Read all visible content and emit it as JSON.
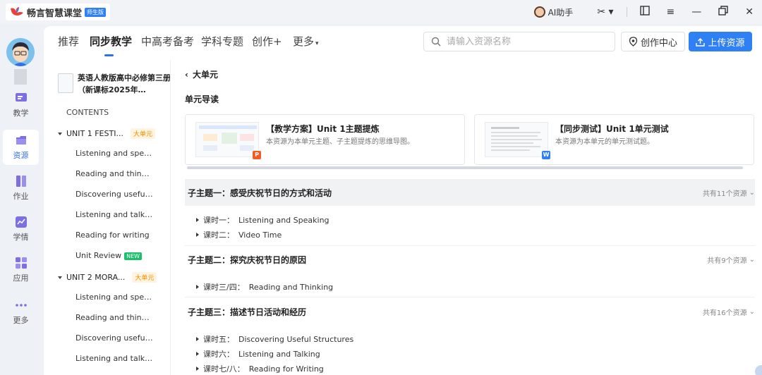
{
  "topbar": {
    "logo_name": "畅言智慧课堂",
    "logo_badge": "师生版",
    "ai_label": "AI助手"
  },
  "rail": {
    "items": [
      {
        "label": "教学",
        "icon": "teach-icon"
      },
      {
        "label": "资源",
        "icon": "resource-icon"
      },
      {
        "label": "作业",
        "icon": "homework-icon"
      },
      {
        "label": "学情",
        "icon": "analytics-icon"
      },
      {
        "label": "应用",
        "icon": "apps-icon"
      },
      {
        "label": "更多",
        "icon": "more-icon"
      }
    ],
    "active": "资源"
  },
  "nav": {
    "tabs": [
      "推荐",
      "同步教学",
      "中高考备考",
      "学科专题",
      "创作+",
      "更多"
    ],
    "active": "同步教学",
    "search_placeholder": "请输入资源名称",
    "center_label": "创作中心",
    "upload_label": "上传资源"
  },
  "toc": {
    "book_title": "英语人教版高中必修第三册（新课标2025年…",
    "contents_label": "CONTENTS",
    "units": [
      {
        "title": "UNIT 1 FESTI...",
        "badge": "大单元",
        "lessons": [
          "Listening and speaking",
          "Reading and thinking",
          "Discovering useful structures",
          "Listening and talking",
          "Reading for writing",
          "Unit Review"
        ],
        "new_badge": "NEW"
      },
      {
        "title": "UNIT 2 MORA...",
        "badge": "大单元",
        "lessons": [
          "Listening and speaking",
          "Reading and thinking",
          "Discovering useful structures",
          "Listening and talking"
        ]
      }
    ]
  },
  "content": {
    "back_label": "大单元",
    "guide_title": "单元导读",
    "cards": [
      {
        "title": "【教学方案】Unit 1主题提炼",
        "desc": "本资源为本单元主题、子主题提炼的思维导图。",
        "type": "P",
        "type_color": "#f25b22"
      },
      {
        "title": "【同步测试】Unit 1单元测试",
        "desc": "本资源为本单元的单元测试题。",
        "type": "W",
        "type_color": "#2f7ff5"
      }
    ],
    "topics": [
      {
        "title": "子主题一：感受庆祝节日的方式和活动",
        "count": "共有11个资源",
        "lessons": [
          {
            "prefix": "课时一：",
            "name": "Listening and Speaking"
          },
          {
            "prefix": "课时二：",
            "name": "Video Time"
          }
        ]
      },
      {
        "title": "子主题二：探究庆祝节日的原因",
        "count": "共有9个资源",
        "lessons": [
          {
            "prefix": "课时三/四：",
            "name": "Reading and Thinking"
          }
        ]
      },
      {
        "title": "子主题三：描述节日活动和经历",
        "count": "共有16个资源",
        "lessons": [
          {
            "prefix": "课时五：",
            "name": "Discovering Useful Structures"
          },
          {
            "prefix": "课时六：",
            "name": "Listening and Talking"
          },
          {
            "prefix": "课时七/八：",
            "name": "Reading for Writing"
          }
        ]
      }
    ]
  }
}
